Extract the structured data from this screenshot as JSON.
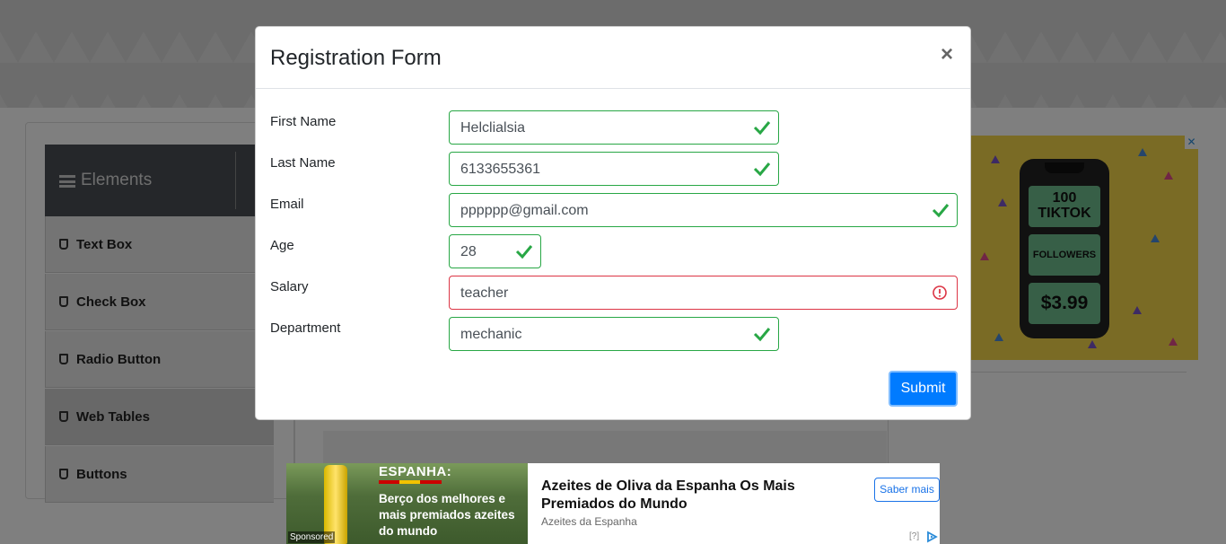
{
  "sidebar": {
    "header_label": "Elements",
    "items": [
      {
        "label": "Text Box"
      },
      {
        "label": "Check Box"
      },
      {
        "label": "Radio Button"
      },
      {
        "label": "Web Tables"
      },
      {
        "label": "Buttons"
      }
    ]
  },
  "right_ad": {
    "tile1": "100 TIKTOK",
    "tile2": "FOLLOWERS",
    "tile3": "$3.99",
    "close": "✕"
  },
  "bottom_ad": {
    "image_title": "ESPANHA:",
    "image_subtitle": "Berço dos melhores e mais premiados azeites do mundo",
    "sponsored": "Sponsored",
    "title": "Azeites de Oliva da Espanha Os Mais Premiados do Mundo",
    "brand": "Azeites da Espanha",
    "button": "Saber mais",
    "question": "[?]"
  },
  "modal": {
    "title": "Registration Form",
    "close": "×",
    "fields": [
      {
        "label": "First Name",
        "value": "Helclialsia",
        "status": "valid"
      },
      {
        "label": "Last Name",
        "value": "6133655361",
        "status": "valid"
      },
      {
        "label": "Email",
        "value": "pppppp@gmail.com",
        "status": "valid"
      },
      {
        "label": "Age",
        "value": "28",
        "status": "valid"
      },
      {
        "label": "Salary",
        "value": "teacher",
        "status": "invalid"
      },
      {
        "label": "Department",
        "value": "mechanic",
        "status": "valid"
      }
    ],
    "submit_label": "Submit"
  },
  "colors": {
    "valid": "#28a745",
    "invalid": "#dc3545",
    "primary": "#007bff"
  }
}
